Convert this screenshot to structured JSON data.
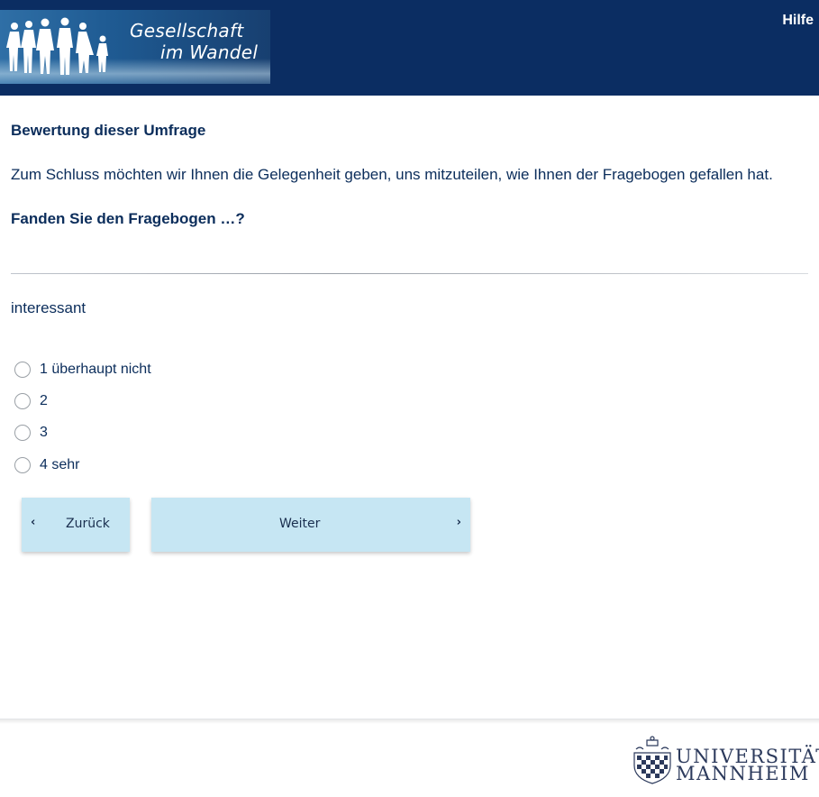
{
  "header": {
    "logo_line1": "Gesellschaft",
    "logo_line2": "im Wandel",
    "help_label": "Hilfe"
  },
  "survey": {
    "section_title": "Bewertung dieser Umfrage",
    "intro": "Zum Schluss möchten wir Ihnen die Gelegenheit geben, uns mitzuteilen, wie Ihnen der Fragebogen gefallen hat.",
    "question": "Fanden Sie den Fragebogen …?",
    "item_label": "interessant",
    "options": [
      "1 überhaupt nicht",
      "2",
      "3",
      "4 sehr"
    ],
    "selected_option": null
  },
  "nav": {
    "back_label": "Zurück",
    "next_label": "Weiter"
  },
  "footer": {
    "university_line1": "UNIVERSITÄT",
    "university_line2": "MANNHEIM"
  },
  "colors": {
    "header_bg": "#0b2d62",
    "text": "#0b2d5b",
    "button_bg": "#c6e6f3"
  }
}
